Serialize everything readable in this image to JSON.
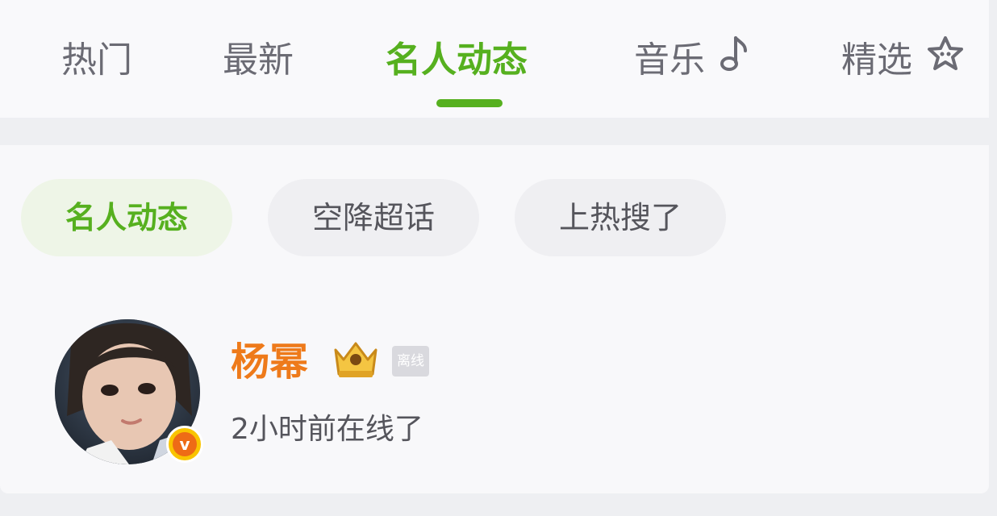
{
  "tabs": [
    {
      "label": "热门"
    },
    {
      "label": "最新"
    },
    {
      "label": "名人动态"
    },
    {
      "label": "音乐"
    },
    {
      "label": "精选"
    }
  ],
  "active_tab": "名人动态",
  "filter_chips": [
    {
      "label": "名人动态"
    },
    {
      "label": "空降超话"
    },
    {
      "label": "上热搜了"
    }
  ],
  "post": {
    "user_name": "杨幂",
    "status_tag": "离线",
    "online_time": "2小时前在线了",
    "verified_badge_letter": "v"
  },
  "colors": {
    "accent_green": "#56b01f",
    "name_orange": "#ee7a1a",
    "badge_yellow": "#f9c400",
    "badge_orange": "#ee6b16"
  },
  "icons": {
    "music_tab": "music-note-icon",
    "featured_tab": "star-outline-icon",
    "crown": "crown-level-icon",
    "verified": "verified-v-icon"
  }
}
